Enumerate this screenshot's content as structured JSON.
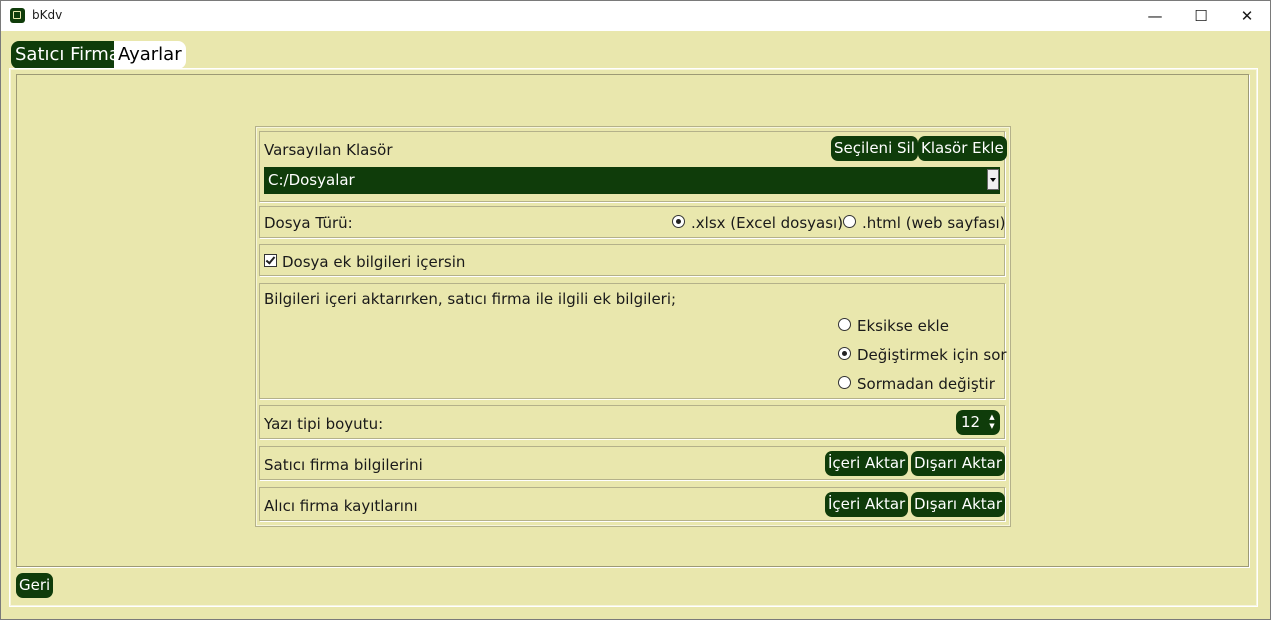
{
  "window": {
    "title": "bKdv"
  },
  "tabs": [
    {
      "label": "Satıcı Firma"
    },
    {
      "label": "Ayarlar"
    }
  ],
  "folder": {
    "label": "Varsayılan Klasör",
    "delete_button": "Seçileni Sil",
    "add_button": "Klasör Ekle",
    "selected": "C:/Dosyalar"
  },
  "file_type": {
    "label": "Dosya Türü:",
    "options": [
      {
        "label": ".xlsx (Excel dosyası)",
        "checked": true
      },
      {
        "label": ".html (web sayfası)",
        "checked": false
      }
    ]
  },
  "extra_info": {
    "label": "Dosya ek bilgileri içersin",
    "checked": true
  },
  "import_behaviour": {
    "label": "Bilgileri içeri aktarırken, satıcı firma ile ilgili ek bilgileri;",
    "options": [
      {
        "label": "Eksikse ekle",
        "checked": false
      },
      {
        "label": "Değiştirmek için sor",
        "checked": true
      },
      {
        "label": "Sormadan değiştir",
        "checked": false
      }
    ]
  },
  "font_size": {
    "label": "Yazı tipi boyutu:",
    "value": "12"
  },
  "seller": {
    "label": "Satıcı firma bilgilerini",
    "import_button": "İçeri Aktar",
    "export_button": "Dışarı Aktar"
  },
  "buyer": {
    "label": "Alıcı firma kayıtlarını",
    "import_button": "İçeri Aktar",
    "export_button": "Dışarı Aktar"
  },
  "back_button": "Geri",
  "colors": {
    "accent": "#0f3c0a",
    "background": "#e9e7ad"
  }
}
